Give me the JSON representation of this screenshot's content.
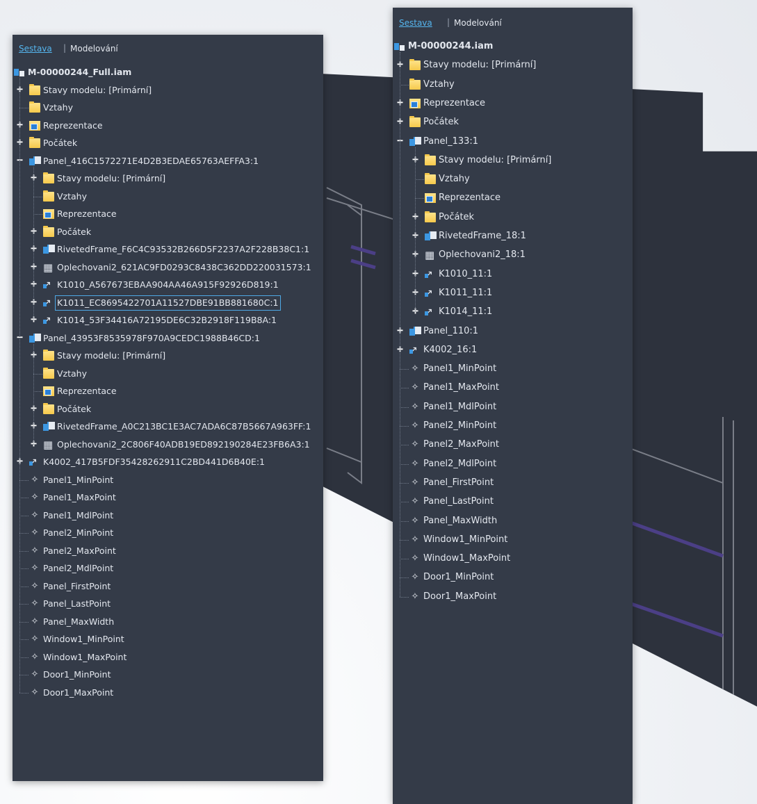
{
  "colors": {
    "panel_bg": "#343b48",
    "tab_active": "#55b6ef",
    "text": "#e3e7ee"
  },
  "panel1": {
    "tabs": {
      "active": "Sestava",
      "inactive": "Modelování"
    },
    "nodes": [
      {
        "label": "M-00000244_Full.iam",
        "depth": 0,
        "icon": "assembly-icon",
        "root": true
      },
      {
        "label": "Stavy modelu: [Primární]",
        "depth": 1,
        "icon": "folder-icon",
        "expander": "plus"
      },
      {
        "label": "Vztahy",
        "depth": 1,
        "icon": "folder-icon"
      },
      {
        "label": "Reprezentace",
        "depth": 1,
        "icon": "representations-icon",
        "expander": "plus"
      },
      {
        "label": "Počátek",
        "depth": 1,
        "icon": "folder-icon",
        "expander": "plus"
      },
      {
        "label": "Panel_416C1572271E4D2B3EDAE65763AEFFA3:1",
        "depth": 1,
        "icon": "subassembly-icon",
        "expander": "minus"
      },
      {
        "label": "Stavy modelu: [Primární]",
        "depth": 2,
        "icon": "folder-icon",
        "expander": "plus"
      },
      {
        "label": "Vztahy",
        "depth": 2,
        "icon": "folder-icon"
      },
      {
        "label": "Reprezentace",
        "depth": 2,
        "icon": "representations-icon"
      },
      {
        "label": "Počátek",
        "depth": 2,
        "icon": "folder-icon",
        "expander": "plus"
      },
      {
        "label": "RivetedFrame_F6C4C93532B266D5F2237A2F228B38C1:1",
        "depth": 2,
        "icon": "subassembly-icon",
        "expander": "plus"
      },
      {
        "label": "Oplechovani2_621AC9FD0293C8438C362DD220031573:1",
        "depth": 2,
        "icon": "sheet-metal-icon",
        "expander": "plus"
      },
      {
        "label": "K1010_A567673EBAA904AA46A915F92926D819:1",
        "depth": 2,
        "icon": "frame-member-icon",
        "expander": "plus"
      },
      {
        "label": "K1011_EC8695422701A11527DBE91BB881680C:1",
        "depth": 2,
        "icon": "frame-member-icon",
        "expander": "plus",
        "selected": true
      },
      {
        "label": "K1014_53F34416A72195DE6C32B2918F119B8A:1",
        "depth": 2,
        "icon": "frame-member-icon",
        "expander": "plus"
      },
      {
        "label": "Panel_43953F8535978F970A9CEDC1988B46CD:1",
        "depth": 1,
        "icon": "subassembly-icon",
        "expander": "minus"
      },
      {
        "label": "Stavy modelu: [Primární]",
        "depth": 2,
        "icon": "folder-icon",
        "expander": "plus"
      },
      {
        "label": "Vztahy",
        "depth": 2,
        "icon": "folder-icon"
      },
      {
        "label": "Reprezentace",
        "depth": 2,
        "icon": "representations-icon"
      },
      {
        "label": "Počátek",
        "depth": 2,
        "icon": "folder-icon",
        "expander": "plus"
      },
      {
        "label": "RivetedFrame_A0C213BC1E3AC7ADA6C87B5667A963FF:1",
        "depth": 2,
        "icon": "subassembly-icon",
        "expander": "plus"
      },
      {
        "label": "Oplechovani2_2C806F40ADB19ED892190284E23FB6A3:1",
        "depth": 2,
        "icon": "sheet-metal-icon",
        "expander": "plus"
      },
      {
        "label": "K4002_417B5FDF35428262911C2BD441D6B40E:1",
        "depth": 1,
        "icon": "frame-member-icon",
        "expander": "plus"
      },
      {
        "label": "Panel1_MinPoint",
        "depth": 1,
        "icon": "work-point-icon"
      },
      {
        "label": "Panel1_MaxPoint",
        "depth": 1,
        "icon": "work-point-icon"
      },
      {
        "label": "Panel1_MdlPoint",
        "depth": 1,
        "icon": "work-point-icon"
      },
      {
        "label": "Panel2_MinPoint",
        "depth": 1,
        "icon": "work-point-icon"
      },
      {
        "label": "Panel2_MaxPoint",
        "depth": 1,
        "icon": "work-point-icon"
      },
      {
        "label": "Panel2_MdlPoint",
        "depth": 1,
        "icon": "work-point-icon"
      },
      {
        "label": "Panel_FirstPoint",
        "depth": 1,
        "icon": "work-point-icon"
      },
      {
        "label": "Panel_LastPoint",
        "depth": 1,
        "icon": "work-point-icon"
      },
      {
        "label": "Panel_MaxWidth",
        "depth": 1,
        "icon": "work-point-icon"
      },
      {
        "label": "Window1_MinPoint",
        "depth": 1,
        "icon": "work-point-icon"
      },
      {
        "label": "Window1_MaxPoint",
        "depth": 1,
        "icon": "work-point-icon"
      },
      {
        "label": "Door1_MinPoint",
        "depth": 1,
        "icon": "work-point-icon"
      },
      {
        "label": "Door1_MaxPoint",
        "depth": 1,
        "icon": "work-point-icon"
      }
    ]
  },
  "panel2": {
    "tabs": {
      "active": "Sestava",
      "inactive": "Modelování"
    },
    "nodes": [
      {
        "label": "M-00000244.iam",
        "depth": 0,
        "icon": "assembly-icon",
        "root": true
      },
      {
        "label": "Stavy modelu: [Primární]",
        "depth": 1,
        "icon": "folder-icon",
        "expander": "plus"
      },
      {
        "label": "Vztahy",
        "depth": 1,
        "icon": "folder-icon"
      },
      {
        "label": "Reprezentace",
        "depth": 1,
        "icon": "representations-icon",
        "expander": "plus"
      },
      {
        "label": "Počátek",
        "depth": 1,
        "icon": "folder-icon",
        "expander": "plus"
      },
      {
        "label": "Panel_133:1",
        "depth": 1,
        "icon": "subassembly-icon",
        "expander": "minus"
      },
      {
        "label": "Stavy modelu: [Primární]",
        "depth": 2,
        "icon": "folder-icon",
        "expander": "plus"
      },
      {
        "label": "Vztahy",
        "depth": 2,
        "icon": "folder-icon"
      },
      {
        "label": "Reprezentace",
        "depth": 2,
        "icon": "representations-icon"
      },
      {
        "label": "Počátek",
        "depth": 2,
        "icon": "folder-icon",
        "expander": "plus"
      },
      {
        "label": "RivetedFrame_18:1",
        "depth": 2,
        "icon": "subassembly-icon",
        "expander": "plus"
      },
      {
        "label": "Oplechovani2_18:1",
        "depth": 2,
        "icon": "sheet-metal-icon",
        "expander": "plus"
      },
      {
        "label": "K1010_11:1",
        "depth": 2,
        "icon": "frame-member-icon",
        "expander": "plus"
      },
      {
        "label": "K1011_11:1",
        "depth": 2,
        "icon": "frame-member-icon",
        "expander": "plus"
      },
      {
        "label": "K1014_11:1",
        "depth": 2,
        "icon": "frame-member-icon",
        "expander": "plus"
      },
      {
        "label": "Panel_110:1",
        "depth": 1,
        "icon": "subassembly-icon",
        "expander": "plus"
      },
      {
        "label": "K4002_16:1",
        "depth": 1,
        "icon": "frame-member-icon",
        "expander": "plus"
      },
      {
        "label": "Panel1_MinPoint",
        "depth": 1,
        "icon": "work-point-icon"
      },
      {
        "label": "Panel1_MaxPoint",
        "depth": 1,
        "icon": "work-point-icon"
      },
      {
        "label": "Panel1_MdlPoint",
        "depth": 1,
        "icon": "work-point-icon"
      },
      {
        "label": "Panel2_MinPoint",
        "depth": 1,
        "icon": "work-point-icon"
      },
      {
        "label": "Panel2_MaxPoint",
        "depth": 1,
        "icon": "work-point-icon"
      },
      {
        "label": "Panel2_MdlPoint",
        "depth": 1,
        "icon": "work-point-icon"
      },
      {
        "label": "Panel_FirstPoint",
        "depth": 1,
        "icon": "work-point-icon"
      },
      {
        "label": "Panel_LastPoint",
        "depth": 1,
        "icon": "work-point-icon"
      },
      {
        "label": "Panel_MaxWidth",
        "depth": 1,
        "icon": "work-point-icon"
      },
      {
        "label": "Window1_MinPoint",
        "depth": 1,
        "icon": "work-point-icon"
      },
      {
        "label": "Window1_MaxPoint",
        "depth": 1,
        "icon": "work-point-icon"
      },
      {
        "label": "Door1_MinPoint",
        "depth": 1,
        "icon": "work-point-icon"
      },
      {
        "label": "Door1_MaxPoint",
        "depth": 1,
        "icon": "work-point-icon"
      }
    ]
  }
}
